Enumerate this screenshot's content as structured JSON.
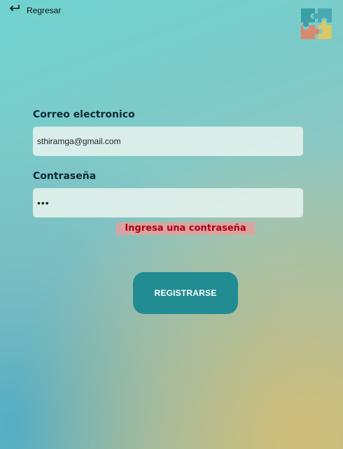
{
  "back": {
    "label": "Regresar",
    "icon": "back-arrow-icon"
  },
  "logo": {
    "icon": "puzzle-icon",
    "colors": [
      "#3aa0a6",
      "#4aa8b3",
      "#d98a6e",
      "#d8c86a"
    ]
  },
  "form": {
    "email_label": "Correo electronico",
    "email_value": "sthiramga@gmail.com",
    "password_label": "Contraseña",
    "password_value": "•••",
    "error_message": "Ingresa una contraseña",
    "submit_label": "REGISTRARSE"
  },
  "colors": {
    "button": "#218d92",
    "error_text": "#b00010",
    "error_background": "#e1a0a0"
  }
}
